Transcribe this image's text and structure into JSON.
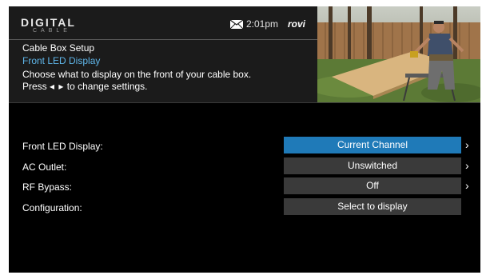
{
  "header": {
    "logo_main": "DIGITAL",
    "logo_sub": "CABLE",
    "time": "2:01pm",
    "brand": "rovi",
    "title": "Cable Box Setup",
    "subtitle": "Front LED Display",
    "description": "Choose what to display on the front of your cable box.",
    "hint_prefix": "Press",
    "hint_arrows": "◂ ▸",
    "hint_suffix": "to change settings."
  },
  "settings": [
    {
      "label": "Front LED Display:",
      "value": "Current Channel",
      "selected": true,
      "has_arrow": true
    },
    {
      "label": "AC Outlet:",
      "value": "Unswitched",
      "selected": false,
      "has_arrow": true
    },
    {
      "label": "RF Bypass:",
      "value": "Off",
      "selected": false,
      "has_arrow": true
    },
    {
      "label": "Configuration:",
      "value": "Select to display",
      "selected": false,
      "has_arrow": false
    }
  ],
  "colors": {
    "accent_blue": "#1f7ab8",
    "subtitle_blue": "#5fb5e8",
    "value_bg": "#3a3a3a"
  },
  "icons": {
    "mail": "envelope-icon",
    "chevron": "chevron-right-icon"
  }
}
